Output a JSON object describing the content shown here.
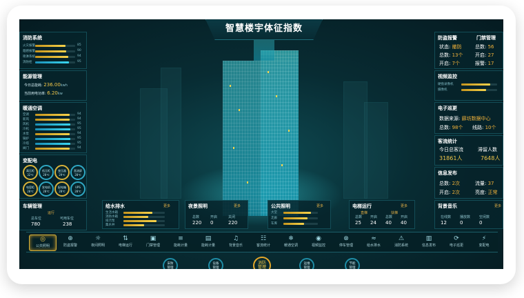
{
  "title": "智慧楼宇体征指数",
  "fire": {
    "title": "消防系统",
    "rows": [
      {
        "label": "火灾报警",
        "value": "85",
        "pct": 0.75,
        "color": "y"
      },
      {
        "label": "烟感报警",
        "value": "90",
        "pct": 0.78,
        "color": "y"
      },
      {
        "label": "喷淋系统",
        "value": "94",
        "pct": 0.82,
        "color": "y"
      },
      {
        "label": "消防栓",
        "value": "95",
        "pct": 0.85,
        "color": "c"
      }
    ]
  },
  "energy": {
    "title": "能源管理",
    "today_label": "今日总能耗:",
    "today_value": "236.00",
    "today_unit": "kwh",
    "current_label": "当前用电功率:",
    "current_value": "6.20",
    "current_unit": "kw"
  },
  "hvac": {
    "title": "暖通空调",
    "rows": [
      {
        "label": "空调",
        "value": "94",
        "pct": 0.86,
        "color": "y"
      },
      {
        "label": "新风",
        "value": "94",
        "pct": 0.86,
        "color": "y"
      },
      {
        "label": "风机",
        "value": "95",
        "pct": 0.88,
        "color": "c"
      },
      {
        "label": "冷机",
        "value": "95",
        "pct": 0.88,
        "color": "c"
      },
      {
        "label": "水泵",
        "value": "94",
        "pct": 0.86,
        "color": "y"
      },
      {
        "label": "锅炉",
        "value": "95",
        "pct": 0.88,
        "color": "c"
      },
      {
        "label": "冷塔",
        "value": "95",
        "pct": 0.88,
        "color": "c"
      },
      {
        "label": "阀门",
        "value": "94",
        "pct": 0.86,
        "color": "y"
      }
    ]
  },
  "power": {
    "title": "变配电",
    "rings": [
      {
        "label": "高压柜",
        "value": "32℃"
      },
      {
        "label": "低压柜",
        "value": "28℃"
      },
      {
        "label": "变压器",
        "value": "29℃"
      },
      {
        "label": "直流屏",
        "value": "28℃"
      },
      {
        "label": "电容柜",
        "value": "28℃"
      },
      {
        "label": "发电机",
        "value": "28℃"
      },
      {
        "label": "配电箱",
        "value": "28℃"
      },
      {
        "label": "UPS",
        "value": "28℃"
      }
    ]
  },
  "vehicle": {
    "title": "车辆管理",
    "status": "运行",
    "total_label": "总车位",
    "total_value": "780",
    "free_label": "可用车位",
    "free_value": "238"
  },
  "water": {
    "title": "给水排水",
    "link": "更多",
    "rows": [
      {
        "label": "生活水箱",
        "pct": 0.7
      },
      {
        "label": "消防水箱",
        "pct": 0.6
      },
      {
        "label": "排污泵",
        "pct": 0.8
      },
      {
        "label": "集水井",
        "pct": 0.5
      }
    ]
  },
  "night": {
    "title": "夜景照明",
    "link": "更多",
    "cols": [
      {
        "label": "总数",
        "value": "220"
      },
      {
        "label": "开启",
        "value": "0"
      },
      {
        "label": "关闭",
        "value": "220"
      }
    ]
  },
  "public_light": {
    "title": "公共照明",
    "link": "更多",
    "rows": [
      {
        "label": "大堂",
        "pct": 0.8
      },
      {
        "label": "走廊",
        "pct": 0.7
      },
      {
        "label": "车库",
        "pct": 0.6
      }
    ]
  },
  "elevator": {
    "title": "电梯运行",
    "link": "更多",
    "group1": "直梯",
    "group2": "扶梯",
    "cols": [
      {
        "label": "总数",
        "value": "25"
      },
      {
        "label": "开启",
        "value": "24"
      },
      {
        "label": "总数",
        "value": "40"
      },
      {
        "label": "开启",
        "value": "40"
      }
    ]
  },
  "intrusion": {
    "title": "防盗报警",
    "status_label": "状态:",
    "status_value": "撤防",
    "total_label": "总数:",
    "total_value": "13个",
    "open_label": "开启:",
    "open_value": "7个"
  },
  "door": {
    "title": "门禁管理",
    "total_label": "总数:",
    "total_value": "56",
    "open_label": "开启:",
    "open_value": "27",
    "alarm_label": "报警:",
    "alarm_value": "17"
  },
  "video": {
    "title": "视频监控",
    "rows": [
      {
        "label": "硬盘录像机",
        "pct": 0.8
      },
      {
        "label": "摄像机",
        "pct": 0.7
      }
    ]
  },
  "patrol": {
    "title": "电子巡更",
    "source_label": "数据来源:",
    "source_value": "廊坊数据中心",
    "total_label": "总数:",
    "total_value": "98个",
    "line_label": "线路:",
    "line_value": "10个"
  },
  "traffic": {
    "title": "客流统计",
    "today_label": "今日总客流",
    "today_value": "31861人",
    "stay_label": "滞留人数",
    "stay_value": "7648人"
  },
  "info": {
    "title": "信息发布",
    "total_label": "总数:",
    "total_value": "2次",
    "stream_label": "流量:",
    "stream_value": "37",
    "open_label": "开启:",
    "open_value": "2次",
    "bright_label": "亮度:",
    "bright_value": "正常"
  },
  "music": {
    "title": "背景音乐",
    "link": "更多",
    "cols": [
      {
        "label": "在线数",
        "value": "12"
      },
      {
        "label": "播放数",
        "value": "0"
      },
      {
        "label": "空闲数",
        "value": "0"
      }
    ]
  },
  "nav": [
    {
      "label": "公共照明",
      "icon": "◎",
      "active": true
    },
    {
      "label": "防盗报警",
      "icon": "⊕"
    },
    {
      "label": "夜间照明",
      "icon": "☼"
    },
    {
      "label": "电梯运行",
      "icon": "⇅"
    },
    {
      "label": "门禁管理",
      "icon": "▣"
    },
    {
      "label": "能耗计量",
      "icon": "≡"
    },
    {
      "label": "能耗计量",
      "icon": "▤"
    },
    {
      "label": "背景音乐",
      "icon": "♫"
    },
    {
      "label": "客流统计",
      "icon": "☷"
    },
    {
      "label": "暖通空调",
      "icon": "❄"
    },
    {
      "label": "视频监控",
      "icon": "◉"
    },
    {
      "label": "停车管理",
      "icon": "⊗"
    },
    {
      "label": "给水排水",
      "icon": "≈"
    },
    {
      "label": "消防系统",
      "icon": "⚠"
    },
    {
      "label": "信息发布",
      "icon": "▥"
    },
    {
      "label": "电子巡更",
      "icon": "⟳"
    },
    {
      "label": "变配电",
      "icon": "⚡"
    }
  ],
  "bottom": [
    {
      "label": "安防\n管理"
    },
    {
      "label": "设备\n管理"
    },
    {
      "label": "消防\n管理",
      "active": true
    },
    {
      "label": "运维\n管理"
    },
    {
      "label": "节能\n管理"
    }
  ]
}
